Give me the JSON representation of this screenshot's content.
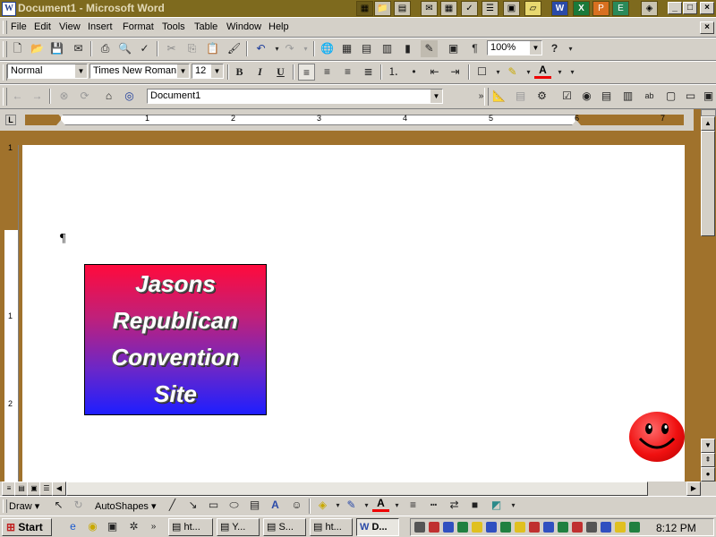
{
  "window": {
    "title": "Document1 - Microsoft Word",
    "app_icon": "W",
    "caption_buttons": [
      "_",
      "□",
      "×"
    ],
    "doc_close": "×"
  },
  "office_bar_icons": [
    "folder-icon",
    "notes-icon",
    "mail-icon",
    "calendar-icon",
    "tasks-icon",
    "contacts-icon",
    "journal-icon",
    "note-icon",
    "word-icon",
    "excel-icon",
    "powerpoint-icon",
    "access-icon",
    "office-icon"
  ],
  "menu": [
    "File",
    "Edit",
    "View",
    "Insert",
    "Format",
    "Tools",
    "Table",
    "Window",
    "Help"
  ],
  "format_toolbar": {
    "style": "Normal",
    "font": "Times New Roman",
    "size": "12",
    "bold": "B",
    "italic": "I",
    "underline": "U"
  },
  "standard_toolbar": {
    "zoom": "100%",
    "help": "?"
  },
  "web_toolbar": {
    "address": "Document1"
  },
  "ruler": {
    "numbers": [
      "1",
      "2",
      "3",
      "4",
      "5",
      "6",
      "7"
    ]
  },
  "vruler": {
    "numbers": [
      "1",
      "1",
      "2"
    ]
  },
  "document": {
    "paragraph_mark": "¶",
    "banner_lines": [
      "Jasons",
      "Republican",
      "Convention",
      "Site"
    ],
    "banner_colors": [
      "#ff0a3c",
      "#1e1eff"
    ]
  },
  "draw_toolbar": {
    "draw": "Draw",
    "autoshapes": "AutoShapes"
  },
  "taskbar": {
    "start": "Start",
    "tasks": [
      "ht...",
      "Y...",
      "S...",
      "ht...",
      "D..."
    ],
    "clock": "8:12 PM"
  }
}
